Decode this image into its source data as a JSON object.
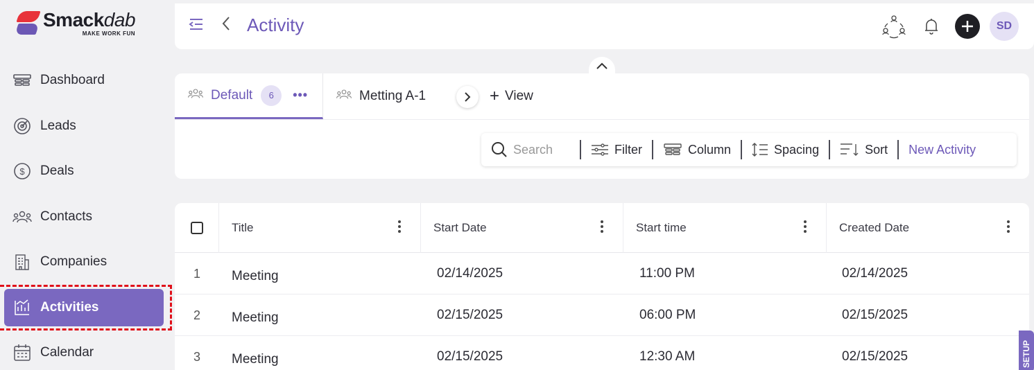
{
  "brand": {
    "name_part1": "Smack",
    "name_part2": "dab",
    "tagline": "MAKE WORK FUN"
  },
  "sidebar": {
    "items": [
      {
        "label": "Dashboard",
        "icon": "dashboard-icon"
      },
      {
        "label": "Leads",
        "icon": "target-icon"
      },
      {
        "label": "Deals",
        "icon": "dollar-icon"
      },
      {
        "label": "Contacts",
        "icon": "contacts-icon"
      },
      {
        "label": "Companies",
        "icon": "building-icon"
      },
      {
        "label": "Activities",
        "icon": "activity-icon",
        "active": true
      },
      {
        "label": "Calendar",
        "icon": "calendar-icon"
      }
    ]
  },
  "header": {
    "title": "Activity",
    "avatar_initials": "SD"
  },
  "tabs": {
    "default_label": "Default",
    "default_count": "6",
    "second_label": "Metting A-1",
    "add_view_label": "View"
  },
  "toolbar": {
    "search_placeholder": "Search",
    "filter_label": "Filter",
    "column_label": "Column",
    "spacing_label": "Spacing",
    "sort_label": "Sort",
    "new_activity_label": "New Activity"
  },
  "table": {
    "columns": [
      "Title",
      "Start Date",
      "Start time",
      "Created Date"
    ],
    "rows": [
      {
        "num": "1",
        "title": "Meeting",
        "start_date": "02/14/2025",
        "start_time": "11:00 PM",
        "created": "02/14/2025"
      },
      {
        "num": "2",
        "title": "Meeting",
        "start_date": "02/15/2025",
        "start_time": "06:00 PM",
        "created": "02/15/2025"
      },
      {
        "num": "3",
        "title": "Meeting",
        "start_date": "02/15/2025",
        "start_time": "12:30 AM",
        "created": "02/15/2025"
      }
    ]
  },
  "setup_tab_label": "SETUP",
  "colors": {
    "accent": "#7a68c0",
    "accent_text": "#6d59b8",
    "brand_red": "#e8323a",
    "highlight": "#e0101a"
  }
}
